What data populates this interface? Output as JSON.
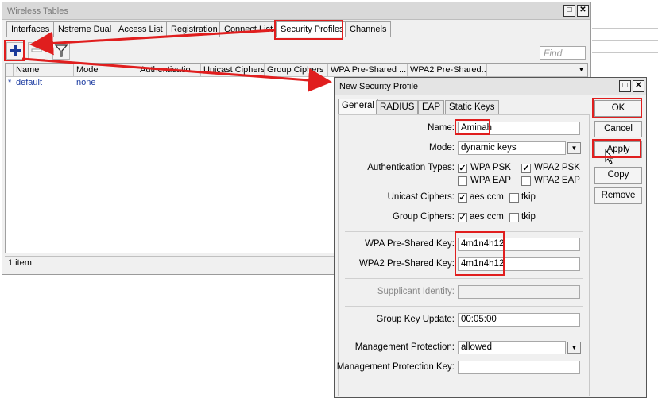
{
  "bg_window": {
    "title": "Wireless Tables",
    "tabs": [
      "Interfaces",
      "Nstreme Dual",
      "Access List",
      "Registration",
      "Connect List",
      "Security Profiles",
      "Channels"
    ],
    "find_placeholder": "Find",
    "columns": [
      "Name",
      "Mode",
      "Authenticatio...",
      "Unicast Ciphers",
      "Group Ciphers",
      "WPA Pre-Shared ...",
      "WPA2 Pre-Shared..."
    ],
    "rows": [
      {
        "marker": "*",
        "name": "default",
        "mode": "none"
      }
    ],
    "status": "1 item"
  },
  "dialog": {
    "title": "New Security Profile",
    "tabs": [
      "General",
      "RADIUS",
      "EAP",
      "Static Keys"
    ],
    "name_label": "Name:",
    "name_value": "Aminah",
    "mode_label": "Mode:",
    "mode_value": "dynamic keys",
    "auth_label": "Authentication Types:",
    "auth_options": [
      {
        "label": "WPA PSK",
        "checked": true
      },
      {
        "label": "WPA2 PSK",
        "checked": true
      },
      {
        "label": "WPA EAP",
        "checked": false
      },
      {
        "label": "WPA2 EAP",
        "checked": false
      }
    ],
    "unicast_label": "Unicast Ciphers:",
    "unicast_options": [
      {
        "label": "aes ccm",
        "checked": true
      },
      {
        "label": "tkip",
        "checked": false
      }
    ],
    "group_label": "Group Ciphers:",
    "group_options": [
      {
        "label": "aes ccm",
        "checked": true
      },
      {
        "label": "tkip",
        "checked": false
      }
    ],
    "wpa_key_label": "WPA Pre-Shared Key:",
    "wpa_key_value": "4m1n4h12",
    "wpa2_key_label": "WPA2 Pre-Shared Key:",
    "wpa2_key_value": "4m1n4h12",
    "supplicant_label": "Supplicant Identity:",
    "supplicant_value": "",
    "group_key_label": "Group Key Update:",
    "group_key_value": "00:05:00",
    "mgmt_prot_label": "Management Protection:",
    "mgmt_prot_value": "allowed",
    "mgmt_key_label": "Management Protection Key:",
    "mgmt_key_value": "",
    "buttons": {
      "ok": "OK",
      "cancel": "Cancel",
      "apply": "Apply",
      "copy": "Copy",
      "remove": "Remove"
    }
  },
  "icons": {
    "add": "plus-icon",
    "remove": "minus-icon",
    "filter": "filter-icon",
    "dropdown": "triangle-down-icon",
    "maximize": "maximize-icon",
    "close": "close-icon",
    "cursor": "mouse-pointer-icon"
  },
  "colors": {
    "highlight": "#e01e1e",
    "add_icon": "#1a3a9a",
    "link_text": "#1a3aa0"
  }
}
